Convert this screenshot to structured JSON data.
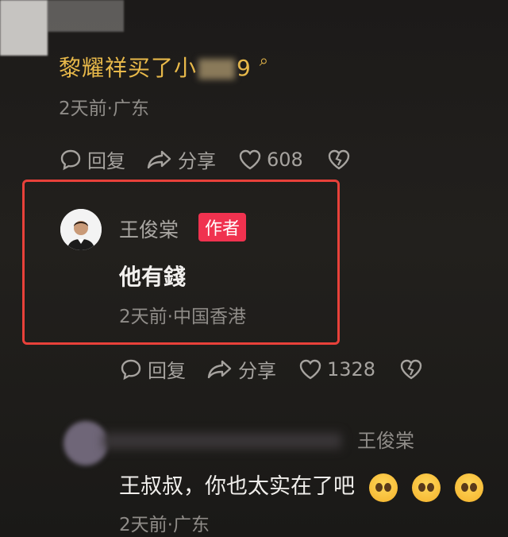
{
  "top_comment": {
    "text": "黎耀祥买了小",
    "text_tail": "9",
    "meta": "2天前·广东",
    "actions": {
      "reply": "回复",
      "share": "分享",
      "likes": "608"
    }
  },
  "author_reply": {
    "name": "王俊棠",
    "badge": "作者",
    "text": "他有錢",
    "meta": "2天前·中国香港",
    "actions": {
      "reply": "回复",
      "share": "分享",
      "likes": "1328"
    }
  },
  "next_comment": {
    "reply_to": "王俊棠",
    "text": "王叔叔，你也太实在了吧",
    "meta": "2天前·广东",
    "emoji_count": 3
  },
  "colors": {
    "link": "#e8b94a",
    "badge": "#f0324f",
    "highlight_border": "#e8413a"
  }
}
